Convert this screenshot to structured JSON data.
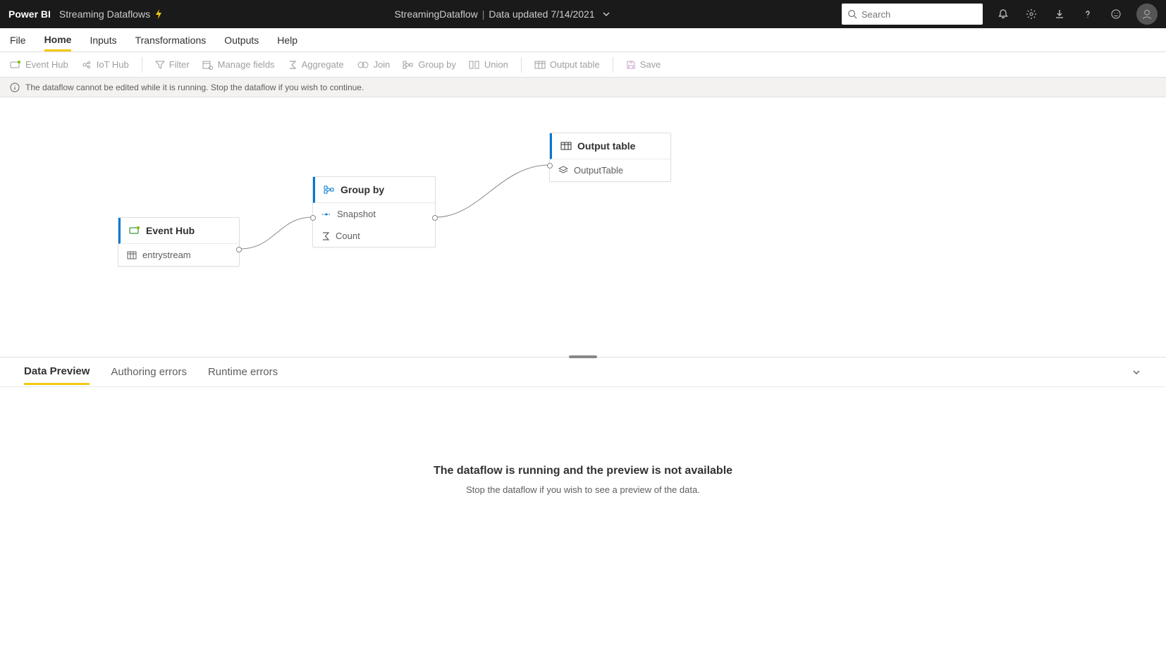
{
  "topbar": {
    "brand": "Power BI",
    "subtitle": "Streaming Dataflows",
    "center_name": "StreamingDataflow",
    "center_status": "Data updated 7/14/2021"
  },
  "search": {
    "placeholder": "Search"
  },
  "tabs": {
    "file": "File",
    "home": "Home",
    "inputs": "Inputs",
    "transformations": "Transformations",
    "outputs": "Outputs",
    "help": "Help"
  },
  "ribbon": {
    "event_hub": "Event Hub",
    "iot_hub": "IoT Hub",
    "filter": "Filter",
    "manage_fields": "Manage fields",
    "aggregate": "Aggregate",
    "join": "Join",
    "group_by": "Group by",
    "union": "Union",
    "output_table": "Output table",
    "save": "Save"
  },
  "banner": {
    "text": "The dataflow cannot be edited while it is running. Stop the dataflow if you wish to continue."
  },
  "nodes": {
    "eventhub": {
      "title": "Event Hub",
      "field": "entrystream"
    },
    "groupby": {
      "title": "Group by",
      "field1": "Snapshot",
      "field2": "Count"
    },
    "output": {
      "title": "Output table",
      "field": "OutputTable"
    }
  },
  "bottom_tabs": {
    "data_preview": "Data Preview",
    "authoring_errors": "Authoring errors",
    "runtime_errors": "Runtime errors"
  },
  "preview": {
    "title": "The dataflow is running and the preview is not available",
    "subtitle": "Stop the dataflow if you wish to see a preview of the data."
  }
}
